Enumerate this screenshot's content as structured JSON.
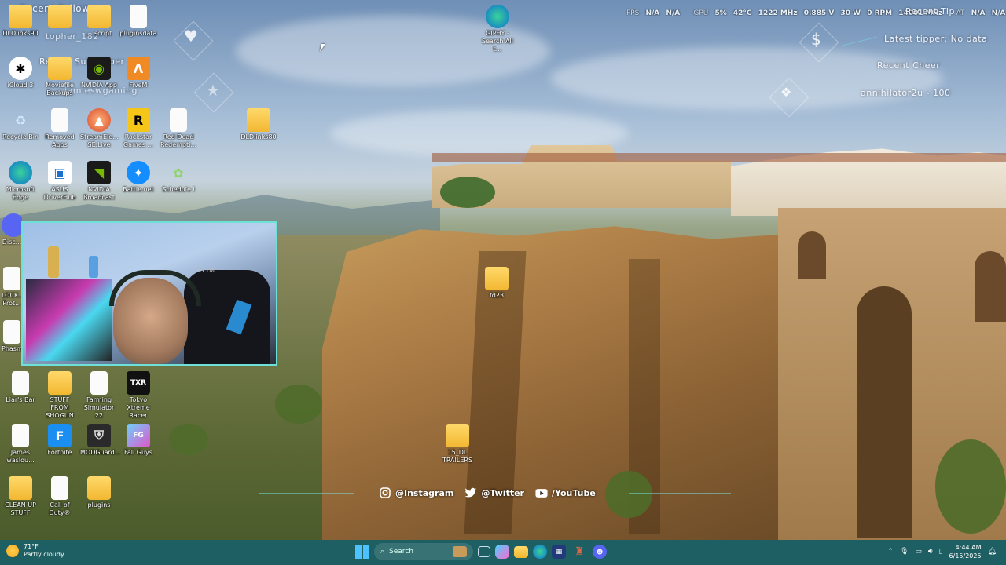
{
  "stats": {
    "fps_label": "FPS",
    "fps_value1": "N/A",
    "fps_value2": "N/A",
    "gpu_label": "GPU",
    "gpu_load": "5%",
    "gpu_temp": "42°C",
    "gpu_clock": "1222 MHz",
    "gpu_voltage": "0.885 V",
    "gpu_power": "30 W",
    "gpu_fan": "0 RPM",
    "gpu_mem_clock": "14001 MHz",
    "extra_label": "AT",
    "extra_value1": "N/A",
    "extra_value2": "N/A"
  },
  "overlay": {
    "recent_follower_label": "Recent Follower",
    "recent_follower_name": "topher_182",
    "recent_subscriber_label": "Recent Subscriber",
    "recent_subscriber_name": "jamieswgaming",
    "recent_tip_label": "Recent Tip",
    "latest_tipper": "Latest tipper: No data",
    "recent_cheer_label": "Recent Cheer",
    "recent_cheer_value": "annihilator2u - 100"
  },
  "desktop_icons": [
    {
      "label": "DLDlinks90",
      "type": "folder"
    },
    {
      "label": "",
      "type": "folder"
    },
    {
      "label": "... script",
      "type": "folder"
    },
    {
      "label": "pluginsdata",
      "type": "file"
    },
    {
      "label": "iCloud 3",
      "type": "app"
    },
    {
      "label": "Moviefile Backups",
      "type": "folder"
    },
    {
      "label": "NVIDIA App",
      "type": "app"
    },
    {
      "label": "FiveM",
      "type": "app"
    },
    {
      "label": "Recycle Bin",
      "type": "app"
    },
    {
      "label": "Removed Apps",
      "type": "app"
    },
    {
      "label": "StreamEle... SE.Live",
      "type": "app"
    },
    {
      "label": "Rockstar Games ...",
      "type": "app"
    },
    {
      "label": "Red Dead Redempti...",
      "type": "file"
    },
    {
      "label": "DLDlinks80",
      "type": "folder"
    },
    {
      "label": "Microsoft Edge",
      "type": "app"
    },
    {
      "label": "ASUS DriverHub",
      "type": "app"
    },
    {
      "label": "NVIDIA Broadcast",
      "type": "app"
    },
    {
      "label": "Battle.net",
      "type": "app"
    },
    {
      "label": "Schedule I",
      "type": "app"
    },
    {
      "label": "GIPHY - Search All t...",
      "type": "app"
    },
    {
      "label": "Disc...",
      "type": "app"
    },
    {
      "label": "LOCK... Prot...",
      "type": "app"
    },
    {
      "label": "Phasm...",
      "type": "app"
    },
    {
      "label": "fd23",
      "type": "folder"
    },
    {
      "label": "Liar's Bar",
      "type": "file"
    },
    {
      "label": "STUFF FROM SHOGUN",
      "type": "folder"
    },
    {
      "label": "Farming Simulator 22",
      "type": "file"
    },
    {
      "label": "Tokyo Xtreme Racer",
      "type": "app"
    },
    {
      "label": "15_DL TRAILERS",
      "type": "folder"
    },
    {
      "label": "James waslou...",
      "type": "file"
    },
    {
      "label": "Fortnite",
      "type": "app"
    },
    {
      "label": "MODGuard...",
      "type": "app"
    },
    {
      "label": "Fall Guys",
      "type": "app"
    },
    {
      "label": "CLEAN UP STUFF",
      "type": "folder"
    },
    {
      "label": "Call of Duty®",
      "type": "file"
    },
    {
      "label": "plugins",
      "type": "folder"
    }
  ],
  "webcam": {
    "brand": "KLIM"
  },
  "socials": {
    "instagram": "@Instagram",
    "twitter": "@Twitter",
    "youtube": "/YouTube"
  },
  "taskbar": {
    "weather_temp": "71°F",
    "weather_desc": "Partly cloudy",
    "search_label": "Search",
    "time": "4:44 AM",
    "date": "6/15/2025",
    "accent": "#1d5f62"
  }
}
